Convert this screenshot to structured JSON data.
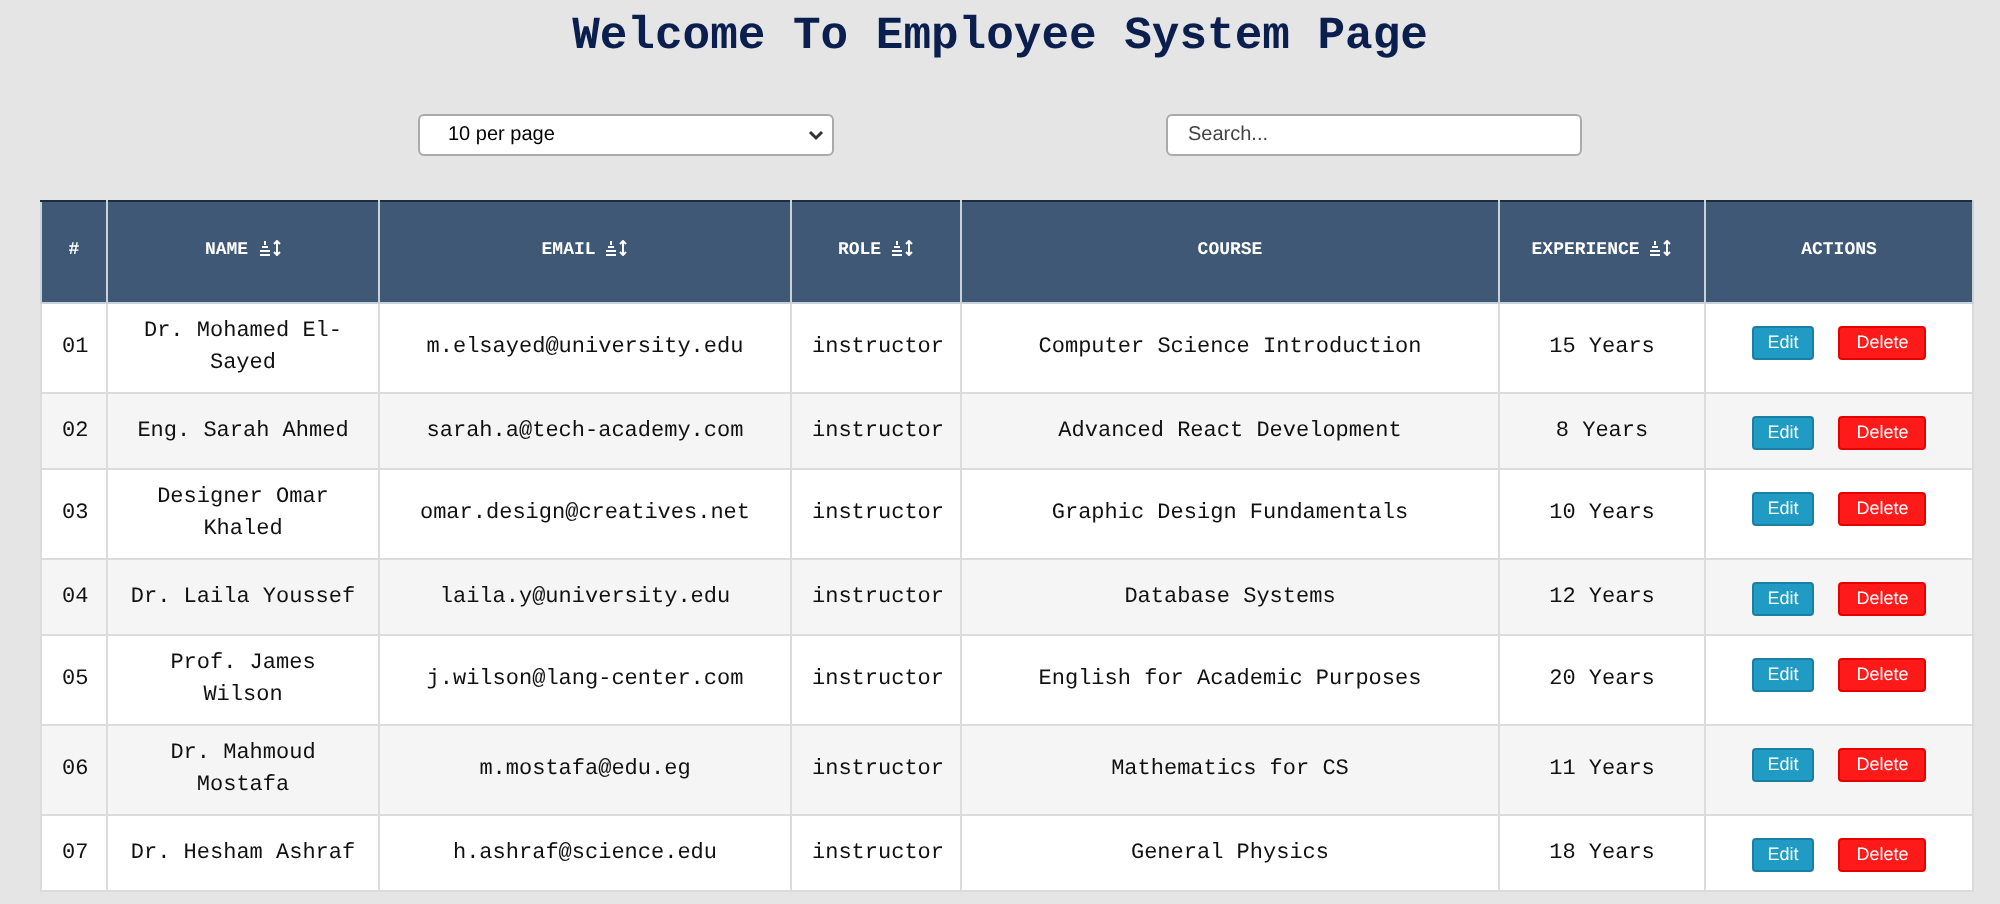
{
  "title": "Welcome To Employee System Page",
  "page_size": {
    "value": "10 per page"
  },
  "search": {
    "placeholder": "Search..."
  },
  "table": {
    "columns": [
      {
        "label": "#",
        "sortable": false
      },
      {
        "label": "NAME",
        "sortable": true
      },
      {
        "label": "EMAIL",
        "sortable": true
      },
      {
        "label": "ROLE",
        "sortable": true
      },
      {
        "label": "COURSE",
        "sortable": false
      },
      {
        "label": "EXPERIENCE",
        "sortable": true
      },
      {
        "label": "ACTIONS",
        "sortable": false
      }
    ],
    "rows": [
      {
        "id": "01",
        "name": "Dr. Mohamed El-Sayed",
        "email": "m.elsayed@university.edu",
        "role": "instructor",
        "course": "Computer Science Introduction",
        "experience": "15 Years",
        "actions": [
          "Edit",
          "Delete"
        ]
      },
      {
        "id": "02",
        "name": "Eng. Sarah Ahmed",
        "email": "sarah.a@tech-academy.com",
        "role": "instructor",
        "course": "Advanced React Development",
        "experience": "8 Years",
        "actions": [
          "Edit",
          "Delete"
        ]
      },
      {
        "id": "03",
        "name": "Designer Omar Khaled",
        "email": "omar.design@creatives.net",
        "role": "instructor",
        "course": "Graphic Design Fundamentals",
        "experience": "10 Years",
        "actions": [
          "Edit",
          "Delete"
        ]
      },
      {
        "id": "04",
        "name": "Dr. Laila Youssef",
        "email": "laila.y@university.edu",
        "role": "instructor",
        "course": "Database Systems",
        "experience": "12 Years",
        "actions": [
          "Edit",
          "Delete"
        ]
      },
      {
        "id": "05",
        "name": "Prof. James Wilson",
        "email": "j.wilson@lang-center.com",
        "role": "instructor",
        "course": "English for Academic Purposes",
        "experience": "20 Years",
        "actions": [
          "Edit",
          "Delete"
        ]
      },
      {
        "id": "06",
        "name": "Dr. Mahmoud Mostafa",
        "email": "m.mostafa@edu.eg",
        "role": "instructor",
        "course": "Mathematics for CS",
        "experience": "11 Years",
        "actions": [
          "Edit",
          "Delete"
        ]
      },
      {
        "id": "07",
        "name": "Dr. Hesham Ashraf",
        "email": "h.ashraf@science.edu",
        "role": "instructor",
        "course": "General Physics",
        "experience": "18 Years",
        "actions": [
          "Edit",
          "Delete"
        ]
      }
    ]
  }
}
